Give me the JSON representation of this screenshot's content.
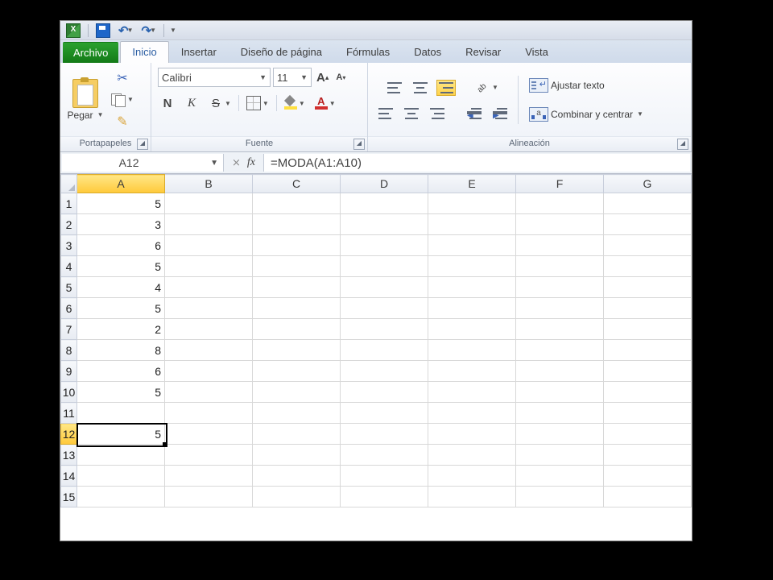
{
  "qat": {
    "undo": "↶",
    "redo": "↷"
  },
  "tabs": {
    "file": "Archivo",
    "items": [
      "Inicio",
      "Insertar",
      "Diseño de página",
      "Fórmulas",
      "Datos",
      "Revisar",
      "Vista"
    ],
    "active_index": 0
  },
  "ribbon": {
    "clipboard": {
      "paste": "Pegar",
      "group": "Portapapeles"
    },
    "font": {
      "name": "Calibri",
      "size": "11",
      "group": "Fuente",
      "bold": "N",
      "italic": "K",
      "underline": "S",
      "grow": "A",
      "shrink": "A",
      "color_letter": "A"
    },
    "align": {
      "group": "Alineación",
      "wrap": "Ajustar texto",
      "merge": "Combinar y centrar"
    }
  },
  "formula_bar": {
    "cell_ref": "A12",
    "fx": "fx",
    "formula": "=MODA(A1:A10)"
  },
  "grid": {
    "columns": [
      "A",
      "B",
      "C",
      "D",
      "E",
      "F",
      "G"
    ],
    "selected_col": 0,
    "selected_row": 12,
    "rows": [
      {
        "n": 1,
        "A": "5"
      },
      {
        "n": 2,
        "A": "3"
      },
      {
        "n": 3,
        "A": "6"
      },
      {
        "n": 4,
        "A": "5"
      },
      {
        "n": 5,
        "A": "4"
      },
      {
        "n": 6,
        "A": "5"
      },
      {
        "n": 7,
        "A": "2"
      },
      {
        "n": 8,
        "A": "8"
      },
      {
        "n": 9,
        "A": "6"
      },
      {
        "n": 10,
        "A": "5"
      },
      {
        "n": 11,
        "A": ""
      },
      {
        "n": 12,
        "A": "5"
      },
      {
        "n": 13,
        "A": ""
      },
      {
        "n": 14,
        "A": ""
      },
      {
        "n": 15,
        "A": ""
      }
    ]
  }
}
